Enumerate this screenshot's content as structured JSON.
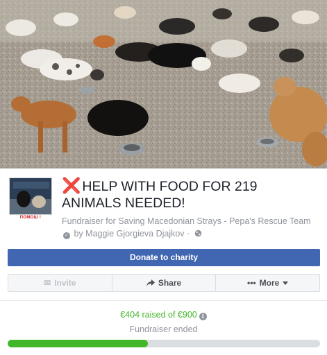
{
  "cover": {
    "alt_icon": "stray-dogs-photo"
  },
  "thumbnail": {
    "caption": "ПОМОШ !"
  },
  "fundraiser": {
    "title_icon": "❌",
    "title": "HELP WITH FOOD FOR 219 ANIMALS NEEDED!",
    "subtitle_prefix": "Fundraiser for Saving Macedonian Strays - Pepa's Rescue Team",
    "subtitle_by": "by Maggie Gjorgieva Djajkov",
    "subtitle_sep": "·"
  },
  "buttons": {
    "donate": "Donate to charity",
    "invite": "Invite",
    "share": "Share",
    "more": "More"
  },
  "progress": {
    "raised_text": "€404 raised of €900",
    "status": "Fundraiser ended",
    "raised": 404,
    "goal": 900
  },
  "colors": {
    "primary": "#4267b2",
    "progress": "#42b72a",
    "title_x": "#e0212b"
  }
}
